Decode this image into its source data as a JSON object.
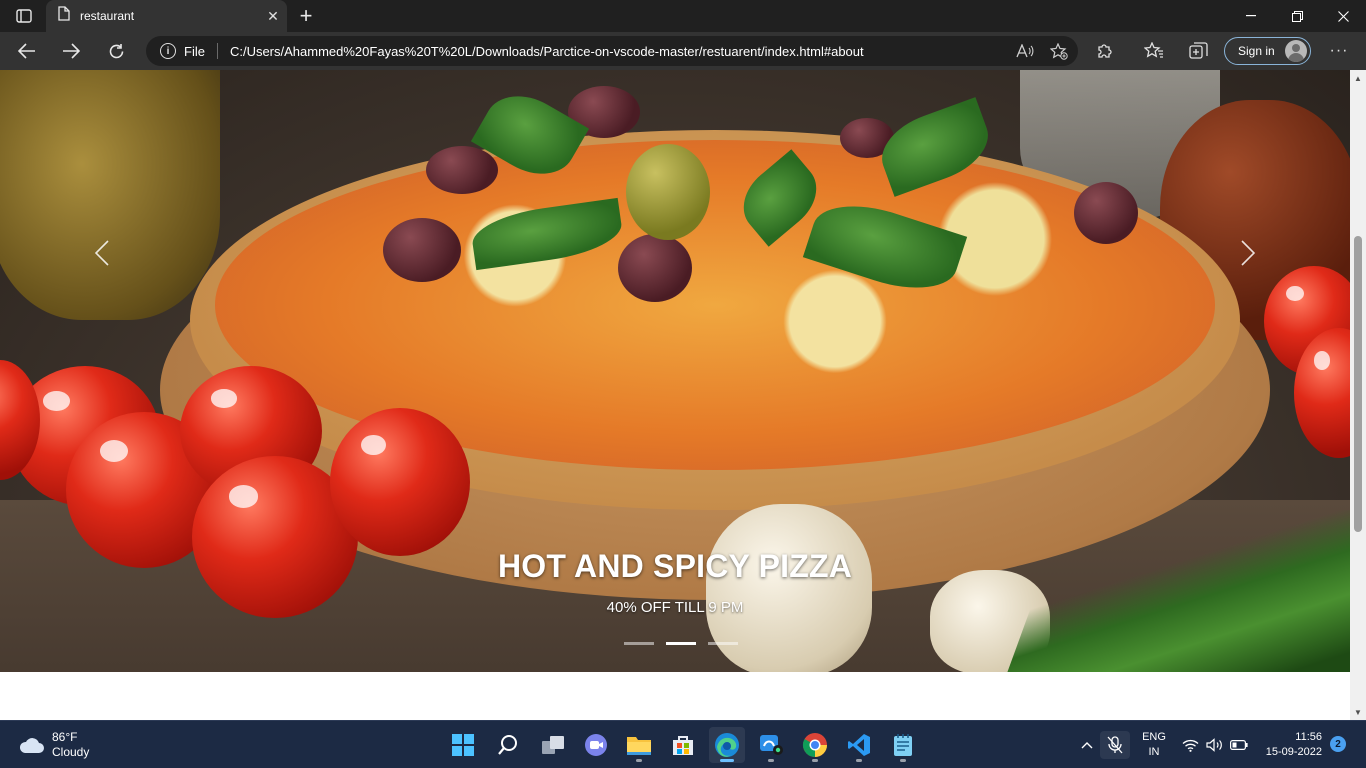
{
  "browser": {
    "tab": {
      "title": "restaurant"
    },
    "address": {
      "scheme_label": "File",
      "url": "C:/Users/Ahammed%20Fayas%20T%20L/Downloads/Parctice-on-vscode-master/restuarent/index.html#about"
    },
    "signin_label": "Sign in"
  },
  "page": {
    "carousel": {
      "caption_title": "HOT AND SPICY PIZZA",
      "caption_subtitle": "40% OFF TILL 9 PM",
      "slides_total": 3,
      "active_slide": 2
    }
  },
  "taskbar": {
    "weather": {
      "temp": "86°F",
      "condition": "Cloudy"
    },
    "language": {
      "line1": "ENG",
      "line2": "IN"
    },
    "clock": {
      "time": "11:56",
      "date": "15-09-2022"
    },
    "notification_count": "2",
    "apps": [
      "start-icon",
      "search-icon",
      "task-view-icon",
      "chat-icon",
      "file-explorer-icon",
      "store-icon",
      "edge-icon",
      "camo-icon",
      "chrome-icon",
      "vscode-icon",
      "notepad-icon"
    ]
  },
  "colors": {
    "browser_frame": "#202020",
    "toolbar": "#333333",
    "taskbar": "#1c2a44",
    "accent": "#6cc0ff"
  }
}
